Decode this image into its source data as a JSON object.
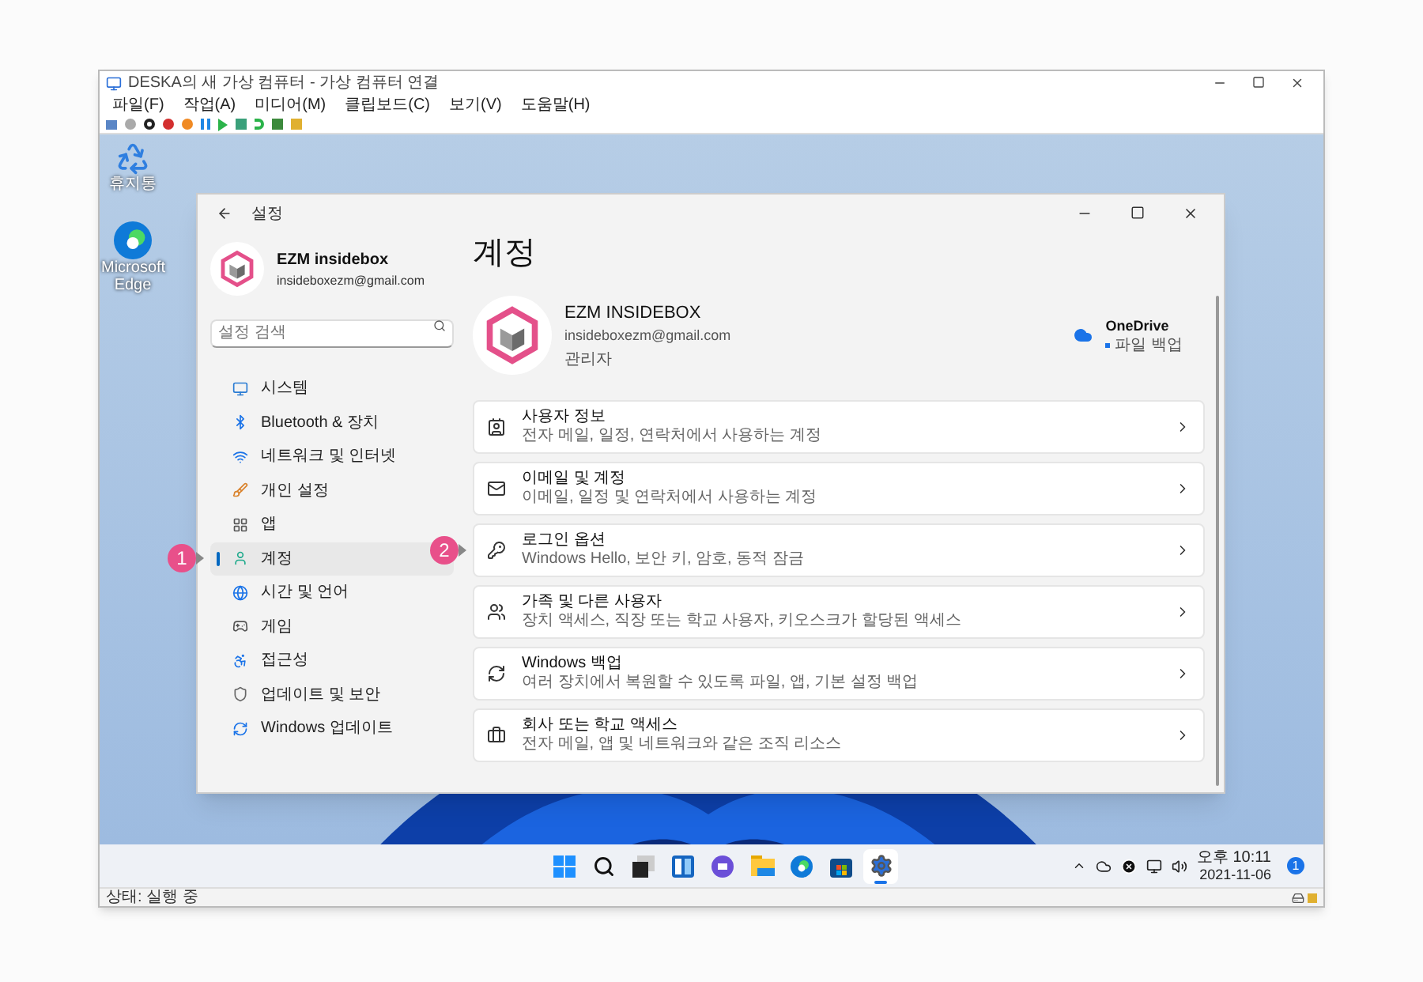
{
  "vm_window": {
    "title": "DESKA의 새 가상 컴퓨터 - 가상 컴퓨터 연결",
    "menu": [
      "파일(F)",
      "작업(A)",
      "미디어(M)",
      "클립보드(C)",
      "보기(V)",
      "도움말(H)"
    ]
  },
  "desktop": {
    "icons": [
      {
        "label": "휴지통",
        "kind": "recycle"
      },
      {
        "label": "Microsoft Edge",
        "kind": "edge"
      }
    ]
  },
  "settings": {
    "title": "설정",
    "user": {
      "name": "EZM insidebox",
      "email": "insideboxezm@gmail.com"
    },
    "search": {
      "placeholder": "설정 검색"
    },
    "nav": [
      {
        "label": "시스템",
        "kind": "system",
        "selected": false
      },
      {
        "label": "Bluetooth & 장치",
        "kind": "bluetooth",
        "selected": false
      },
      {
        "label": "네트워크 및 인터넷",
        "kind": "network",
        "selected": false
      },
      {
        "label": "개인 설정",
        "kind": "brush",
        "selected": false
      },
      {
        "label": "앱",
        "kind": "apps",
        "selected": false
      },
      {
        "label": "계정",
        "kind": "account",
        "selected": true,
        "annotation": "1"
      },
      {
        "label": "시간 및 언어",
        "kind": "globe",
        "selected": false
      },
      {
        "label": "게임",
        "kind": "game",
        "selected": false
      },
      {
        "label": "접근성",
        "kind": "access",
        "selected": false
      },
      {
        "label": "업데이트 및 보안",
        "kind": "shield",
        "selected": false
      },
      {
        "label": "Windows 업데이트",
        "kind": "update",
        "selected": false
      }
    ],
    "page_title": "계정",
    "profile": {
      "name": "EZM INSIDEBOX",
      "email": "insideboxezm@gmail.com",
      "role": "관리자"
    },
    "onedrive": {
      "name": "OneDrive",
      "status": "파일 백업"
    },
    "cards": [
      {
        "title": "사용자 정보",
        "subtitle": "전자 메일, 일정, 연락처에서 사용하는 계정",
        "kind": "userinfo"
      },
      {
        "title": "이메일 및 계정",
        "subtitle": "이메일, 일정 및 연락처에서 사용하는 계정",
        "kind": "mail"
      },
      {
        "title": "로그인 옵션",
        "subtitle": "Windows Hello, 보안 키, 암호, 동적 잠금",
        "kind": "key",
        "annotation": "2"
      },
      {
        "title": "가족 및 다른 사용자",
        "subtitle": "장치 액세스, 직장 또는 학교 사용자, 키오스크가 할당된 액세스",
        "kind": "family"
      },
      {
        "title": "Windows 백업",
        "subtitle": "여러 장치에서 복원할 수 있도록 파일, 앱, 기본 설정 백업",
        "kind": "backup"
      },
      {
        "title": "회사 또는 학교 액세스",
        "subtitle": "전자 메일, 앱 및 네트워크와 같은 조직 리소스",
        "kind": "briefcase"
      }
    ]
  },
  "taskbar": {
    "apps": [
      {
        "kind": "start",
        "selected": false
      },
      {
        "kind": "search",
        "selected": false
      },
      {
        "kind": "taskview",
        "selected": false
      },
      {
        "kind": "widgets",
        "selected": false
      },
      {
        "kind": "chat",
        "selected": false
      },
      {
        "kind": "explorer",
        "selected": false
      },
      {
        "kind": "edge",
        "selected": false
      },
      {
        "kind": "store",
        "selected": false
      },
      {
        "kind": "settings",
        "selected": true
      }
    ],
    "time": "오후 10:11",
    "date": "2021-11-06",
    "notification_count": "1"
  },
  "status_bar": {
    "text": "상태: 실행 중"
  }
}
